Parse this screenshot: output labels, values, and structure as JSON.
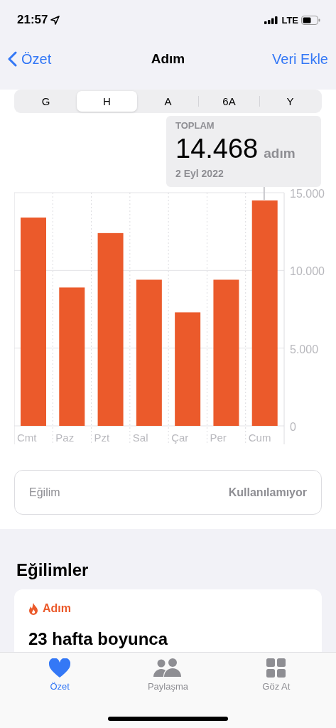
{
  "status_bar": {
    "time": "21:57",
    "network": "LTE"
  },
  "nav": {
    "back": "Özet",
    "title": "Adım",
    "action": "Veri Ekle"
  },
  "ranges": [
    {
      "label": "G",
      "selected": false
    },
    {
      "label": "H",
      "selected": true
    },
    {
      "label": "A",
      "selected": false
    },
    {
      "label": "6A",
      "selected": false
    },
    {
      "label": "Y",
      "selected": false
    }
  ],
  "summary": {
    "label": "TOPLAM",
    "value": "14.468",
    "unit": "adım",
    "date": "2 Eyl 2022"
  },
  "chart_data": {
    "type": "bar",
    "categories": [
      "Cmt",
      "Paz",
      "Pzt",
      "Sal",
      "Çar",
      "Per",
      "Cum"
    ],
    "values": [
      13400,
      8900,
      12400,
      9400,
      7300,
      9400,
      14500
    ],
    "ylim": [
      0,
      15000
    ],
    "yticks": [
      {
        "value": 0,
        "label": "0"
      },
      {
        "value": 5000,
        "label": "5.000"
      },
      {
        "value": 10000,
        "label": "10.000"
      },
      {
        "value": 15000,
        "label": "15.000"
      }
    ]
  },
  "trend_row": {
    "label": "Eğilim",
    "value": "Kullanılamıyor"
  },
  "trends": {
    "title": "Eğilimler",
    "card": {
      "category": "Adım",
      "headline": "23 hafta boyunca"
    }
  },
  "tab_bar": [
    {
      "label": "Özet",
      "selected": true
    },
    {
      "label": "Paylaşma",
      "selected": false
    },
    {
      "label": "Göz At",
      "selected": false
    }
  ]
}
